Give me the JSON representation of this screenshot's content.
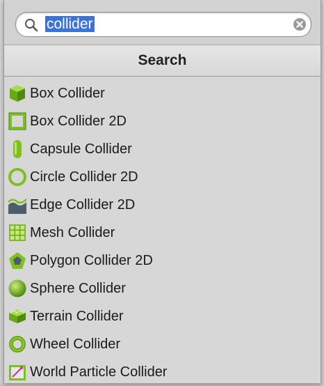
{
  "search": {
    "value": "collider"
  },
  "header": {
    "title": "Search"
  },
  "results": [
    {
      "label": "Box Collider",
      "icon": "box-collider-icon"
    },
    {
      "label": "Box Collider 2D",
      "icon": "box-collider-2d-icon"
    },
    {
      "label": "Capsule Collider",
      "icon": "capsule-collider-icon"
    },
    {
      "label": "Circle Collider 2D",
      "icon": "circle-collider-2d-icon"
    },
    {
      "label": "Edge Collider 2D",
      "icon": "edge-collider-2d-icon"
    },
    {
      "label": "Mesh Collider",
      "icon": "mesh-collider-icon"
    },
    {
      "label": "Polygon Collider 2D",
      "icon": "polygon-collider-2d-icon"
    },
    {
      "label": "Sphere Collider",
      "icon": "sphere-collider-icon"
    },
    {
      "label": "Terrain Collider",
      "icon": "terrain-collider-icon"
    },
    {
      "label": "Wheel Collider",
      "icon": "wheel-collider-icon"
    },
    {
      "label": "World Particle Collider",
      "icon": "world-particle-collider-icon"
    }
  ],
  "colors": {
    "accent_green": "#7fbf1f",
    "selection_blue": "#3b73d9",
    "panel_bg": "#d7d7d7"
  }
}
